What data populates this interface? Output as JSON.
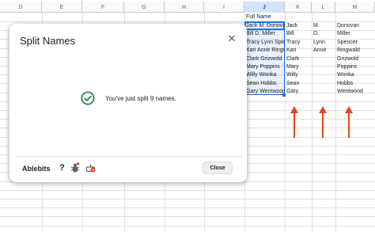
{
  "sheet": {
    "columns": [
      "D",
      "E",
      "F",
      "G",
      "H",
      "I",
      "J",
      "K",
      "L",
      "M"
    ],
    "selected_column": "J",
    "header_cell": "Full Name",
    "rows": [
      {
        "full": "Jack M. Donovan",
        "first": "Jack",
        "middle": "M.",
        "last": "Donovan"
      },
      {
        "full": "Bill D. Miller",
        "first": "Bill",
        "middle": "D.",
        "last": "Miller"
      },
      {
        "full": "Tracy Lynn Spencer",
        "first": "Tracy",
        "middle": "Lynn",
        "last": "Spencer"
      },
      {
        "full": "Kari Anne Ringwald",
        "first": "Kari",
        "middle": "Anne",
        "last": "Ringwald"
      },
      {
        "full": "Clark Grizwold",
        "first": "Clark",
        "middle": "",
        "last": "Grizwold"
      },
      {
        "full": "Mary Poppins",
        "first": "Mary",
        "middle": "",
        "last": "Poppins"
      },
      {
        "full": "Willy Wonka",
        "first": "Willy",
        "middle": "",
        "last": "Wonka"
      },
      {
        "full": "Sean Hobbs",
        "first": "Sean",
        "middle": "",
        "last": "Hobbs"
      },
      {
        "full": "Gary Wentwood",
        "first": "Gary",
        "middle": "",
        "last": "Wentwood"
      }
    ],
    "arrow_color": "#e8451e",
    "selection_color": "#1a73e8"
  },
  "dialog": {
    "title": "Split Names",
    "close_icon": "close-icon",
    "message": "You've just split 9 names.",
    "success_icon": "check-circle-icon",
    "success_color": "#188038",
    "footer": {
      "brand": "Ablebits",
      "help_label": "?",
      "bug_icon": "bug-icon",
      "cake_icon": "cake-icon",
      "close_button": "Close"
    }
  }
}
